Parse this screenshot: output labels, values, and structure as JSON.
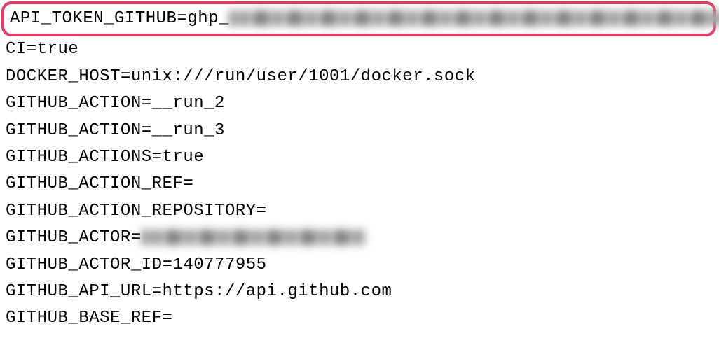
{
  "env": {
    "line0_key": "API_TOKEN_GITHUB",
    "line0_prefix": "ghp_",
    "line1": "CI=true",
    "line2": "DOCKER_HOST=unix:///run/user/1001/docker.sock",
    "line3": "GITHUB_ACTION=__run_2",
    "line4": "GITHUB_ACTION=__run_3",
    "line5": "GITHUB_ACTIONS=true",
    "line6": "GITHUB_ACTION_REF=",
    "line7": "GITHUB_ACTION_REPOSITORY=",
    "line8_key": "GITHUB_ACTOR=",
    "line9": "GITHUB_ACTOR_ID=140777955",
    "line10": "GITHUB_API_URL=https://api.github.com",
    "line11": "GITHUB_BASE_REF="
  }
}
